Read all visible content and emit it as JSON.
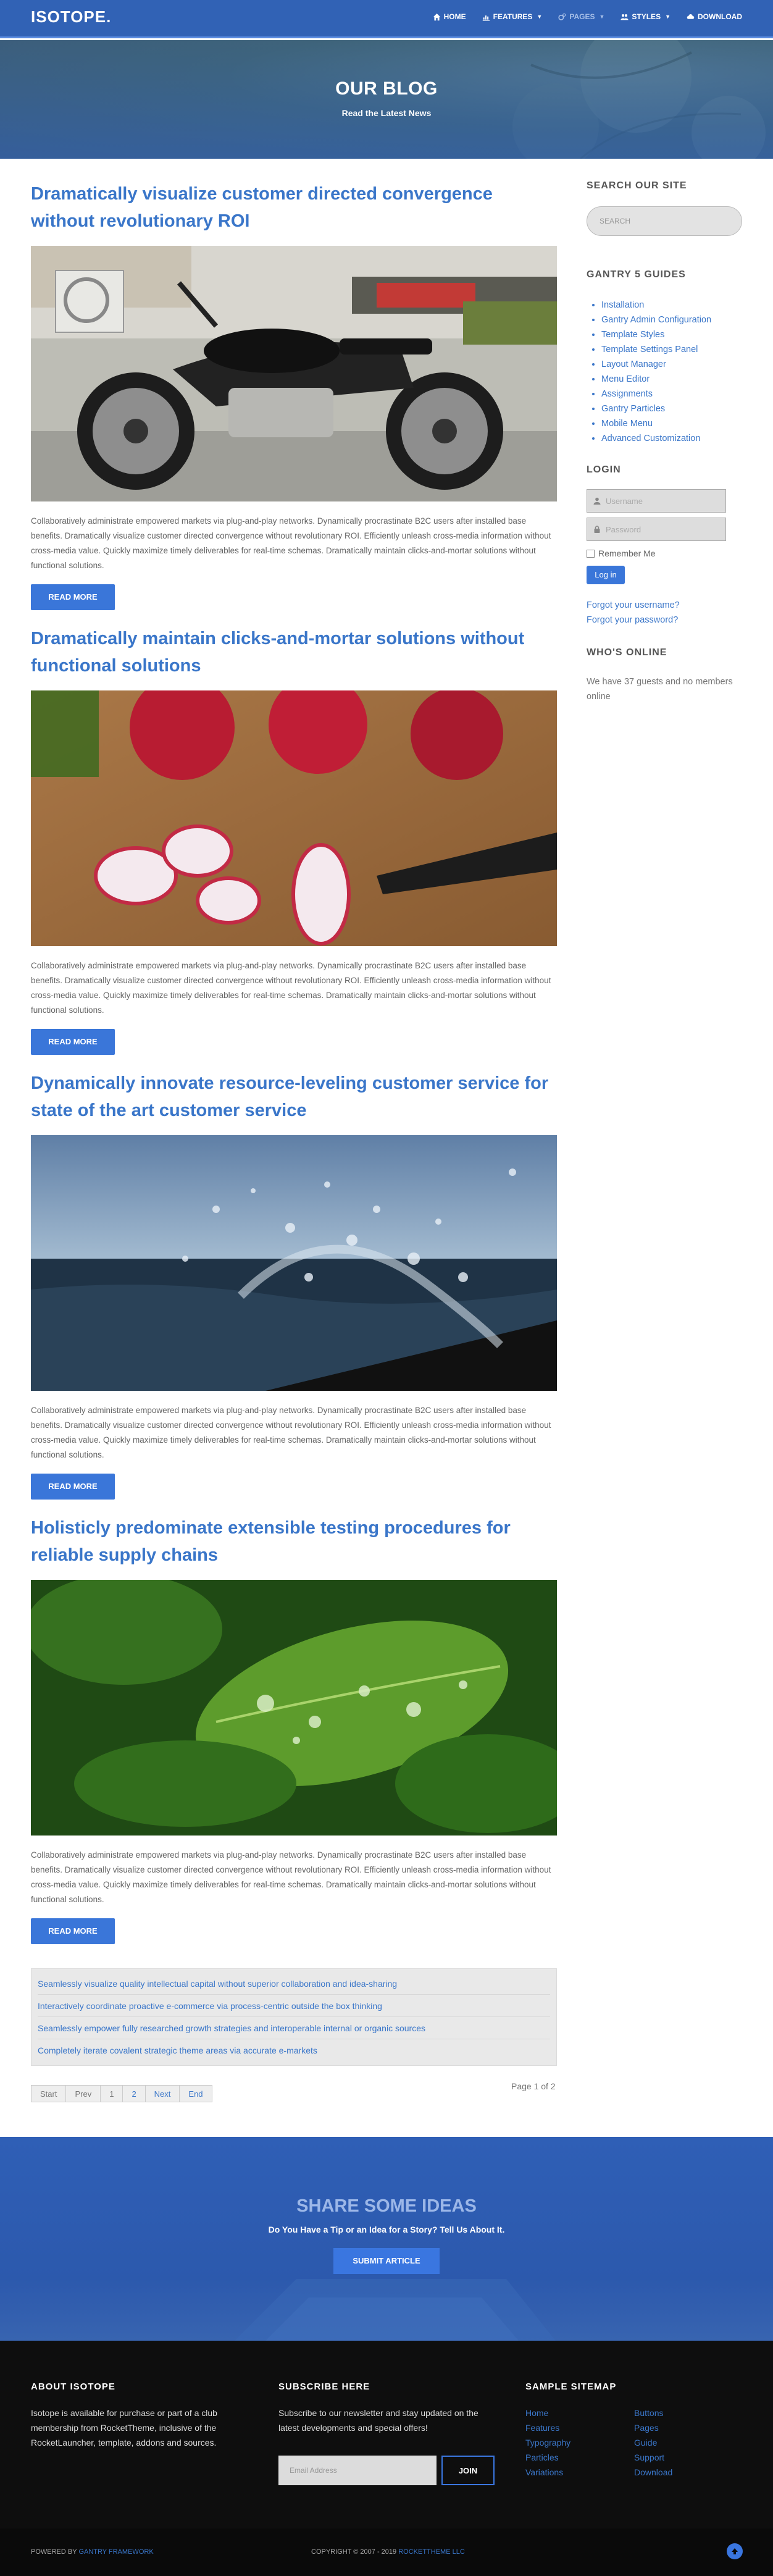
{
  "header": {
    "logo": "ISOTOPE.",
    "nav": [
      {
        "label": "Home",
        "icon": "home-icon"
      },
      {
        "label": "Features",
        "icon": "chart-icon",
        "has_menu": true
      },
      {
        "label": "Pages",
        "icon": "gears-icon",
        "has_menu": true
      },
      {
        "label": "Styles",
        "icon": "users-icon",
        "has_menu": true
      },
      {
        "label": "Download",
        "icon": "download-icon"
      }
    ]
  },
  "hero": {
    "title": "OUR BLOG",
    "subtitle": "Read the Latest News"
  },
  "articles": [
    {
      "title": "Dramatically visualize customer directed convergence without revolutionary ROI",
      "body": "Collaboratively administrate empowered markets via plug-and-play networks. Dynamically procrastinate B2C users after installed base benefits. Dramatically visualize customer directed convergence without revolutionary ROI. Efficiently unleash cross-media information without cross-media value. Quickly maximize timely deliverables for real-time schemas. Dramatically maintain clicks-and-mortar solutions without functional solutions.",
      "read_more": "Read More",
      "image": "motorcycle-photo"
    },
    {
      "title": "Dramatically maintain clicks-and-mortar solutions without functional solutions",
      "body": "Collaboratively administrate empowered markets via plug-and-play networks. Dynamically procrastinate B2C users after installed base benefits. Dramatically visualize customer directed convergence without revolutionary ROI. Efficiently unleash cross-media information without cross-media value. Quickly maximize timely deliverables for real-time schemas. Dramatically maintain clicks-and-mortar solutions without functional solutions.",
      "read_more": "Read More",
      "image": "radishes-photo"
    },
    {
      "title": "Dynamically innovate resource-leveling customer service for state of the art customer service",
      "body": "Collaboratively administrate empowered markets via plug-and-play networks. Dynamically procrastinate B2C users after installed base benefits. Dramatically visualize customer directed convergence without revolutionary ROI. Efficiently unleash cross-media information without cross-media value. Quickly maximize timely deliverables for real-time schemas. Dramatically maintain clicks-and-mortar solutions without functional solutions.",
      "read_more": "Read More",
      "image": "water-splash-photo"
    },
    {
      "title": "Holisticly predominate extensible testing procedures for reliable supply chains",
      "body": "Collaboratively administrate empowered markets via plug-and-play networks. Dynamically procrastinate B2C users after installed base benefits. Dramatically visualize customer directed convergence without revolutionary ROI. Efficiently unleash cross-media information without cross-media value. Quickly maximize timely deliverables for real-time schemas. Dramatically maintain clicks-and-mortar solutions without functional solutions.",
      "read_more": "Read More",
      "image": "green-leaves-photo"
    }
  ],
  "more_articles": [
    "Seamlessly visualize quality intellectual capital without superior collaboration and idea-sharing",
    "Interactively coordinate proactive e-commerce via process-centric outside the box thinking",
    "Seamlessly empower fully researched growth strategies and interoperable internal or organic sources",
    "Completely iterate covalent strategic theme areas via accurate e-markets"
  ],
  "pagination": {
    "items": [
      "Start",
      "Prev",
      "1",
      "2",
      "Next",
      "End"
    ],
    "page_count": "Page 1 of 2"
  },
  "sidebar": {
    "search_title": "Search Our Site",
    "search_placeholder": "SEARCH",
    "guides_title": "Gantry 5 Guides",
    "guides": [
      "Installation",
      "Gantry Admin Configuration",
      "Template Styles",
      "Template Settings Panel",
      "Layout Manager",
      "Menu Editor",
      "Assignments",
      "Gantry Particles",
      "Mobile Menu",
      "Advanced Customization"
    ],
    "login_title": "Login",
    "username_placeholder": "Username",
    "password_placeholder": "Password",
    "remember_label": "Remember Me",
    "login_button": "Log in",
    "forgot_username": "Forgot your username?",
    "forgot_password": "Forgot your password?",
    "online_title": "Who's Online",
    "online_text": "We have 37 guests and no members online"
  },
  "share": {
    "title": "SHARE SOME IDEAS",
    "subtitle": "Do You Have a Tip or an Idea for a Story? Tell Us About It.",
    "button": "Submit Article"
  },
  "footer": {
    "about_title": "About Isotope",
    "about_text": "Isotope is available for purchase or part of a club membership from RocketTheme, inclusive of the RocketLauncher, template, addons and sources.",
    "subscribe_title": "Subscribe Here",
    "subscribe_text": "Subscribe to our newsletter and stay updated on the latest developments and special offers!",
    "email_placeholder": "Email Address",
    "join_button": "Join",
    "sitemap_title": "Sample Sitemap",
    "sitemap": [
      "Home",
      "Buttons",
      "Features",
      "Pages",
      "Typography",
      "Guide",
      "Particles",
      "Support",
      "Variations",
      "Download"
    ]
  },
  "bottom": {
    "powered_prefix": "Powered by",
    "powered_link": "Gantry Framework",
    "copyright_prefix": "Copyright © 2007 - 2019",
    "copyright_link": "RocketTheme LLC"
  },
  "colors": {
    "primary": "#3a76d9",
    "header_bg": "#3162b5",
    "footer_bg": "#0e0e0e"
  }
}
